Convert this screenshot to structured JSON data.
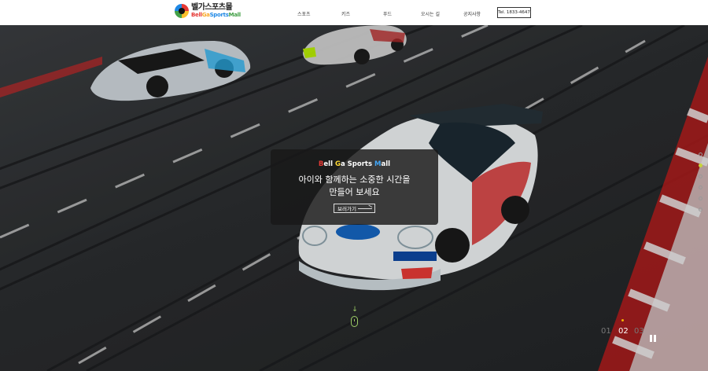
{
  "brand": {
    "name_ko": "벨가스포츠몰",
    "name_en_parts": [
      "Bell",
      "Ga",
      "Sports",
      "Mall"
    ]
  },
  "nav": {
    "items": [
      "스포츠",
      "키즈",
      "푸드",
      "오시는 길",
      "공지사항"
    ],
    "tel": "Tel. 1833-4647"
  },
  "hero": {
    "brand_parts": [
      {
        "initial": "B",
        "rest": "ell"
      },
      {
        "initial": "G",
        "rest": "a"
      },
      {
        "initial": "S",
        "rest": "ports"
      },
      {
        "initial": "M",
        "rest": "all"
      }
    ],
    "title_line1": "아이와 함께하는 소중한 시간을",
    "title_line2": "만들어 보세요",
    "button_label": "보러가기"
  },
  "slider": {
    "pages": [
      "01",
      "02",
      "03"
    ],
    "active_page": "02"
  },
  "colors": {
    "accent_red": "#e53935",
    "accent_yellow": "#fdd835",
    "accent_blue": "#42a5f5",
    "indicator_green": "#c6d43a"
  },
  "icons": {
    "scroll": "mouse-scroll-icon",
    "pause": "pause-icon",
    "arrow": "long-arrow-right-icon"
  }
}
